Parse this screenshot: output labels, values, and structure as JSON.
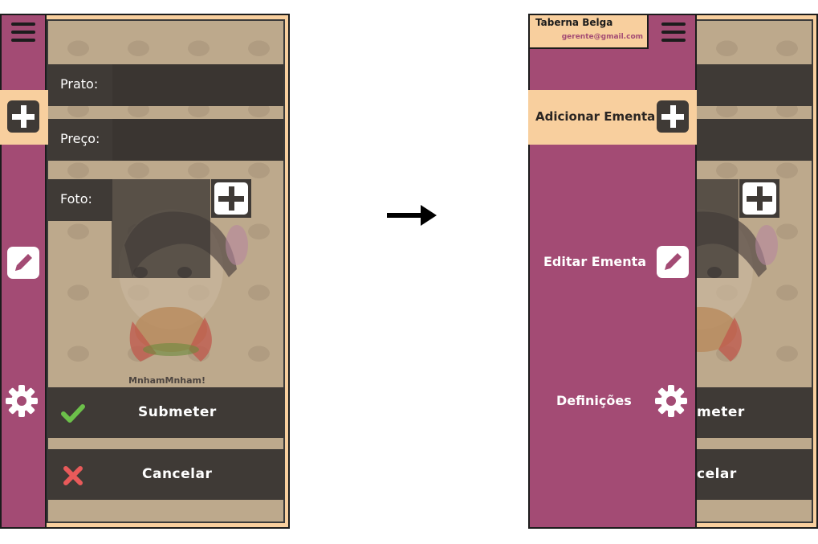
{
  "colors": {
    "sidebar": "#a34b74",
    "frame": "#f8cf9e",
    "dark_row": "#3f3a36",
    "check": "#6cc04a",
    "cross": "#e85a5a",
    "highlight": "#f8cf9e"
  },
  "left": {
    "menu_icon": "hamburger-icon",
    "sidebar_icons": [
      "plus-icon",
      "pencil-icon",
      "gear-icon"
    ],
    "form": {
      "prato_label": "Prato:",
      "preco_label": "Preço:",
      "foto_label": "Foto:",
      "prato_value": "",
      "preco_value": ""
    },
    "photo_caption": "MnhamMnham!",
    "submit_label": "Submeter",
    "cancel_label": "Cancelar"
  },
  "arrow": "arrow-right-icon",
  "right": {
    "user_name": "Taberna Belga",
    "user_email": "gerente@gmail.com",
    "menu_items": [
      {
        "label": "Adicionar Ementa",
        "icon": "plus-icon",
        "selected": true
      },
      {
        "label": "Editar Ementa",
        "icon": "pencil-icon",
        "selected": false
      },
      {
        "label": "Definições",
        "icon": "gear-icon",
        "selected": false
      }
    ],
    "submit_partial": "meter",
    "cancel_partial": "celar"
  }
}
